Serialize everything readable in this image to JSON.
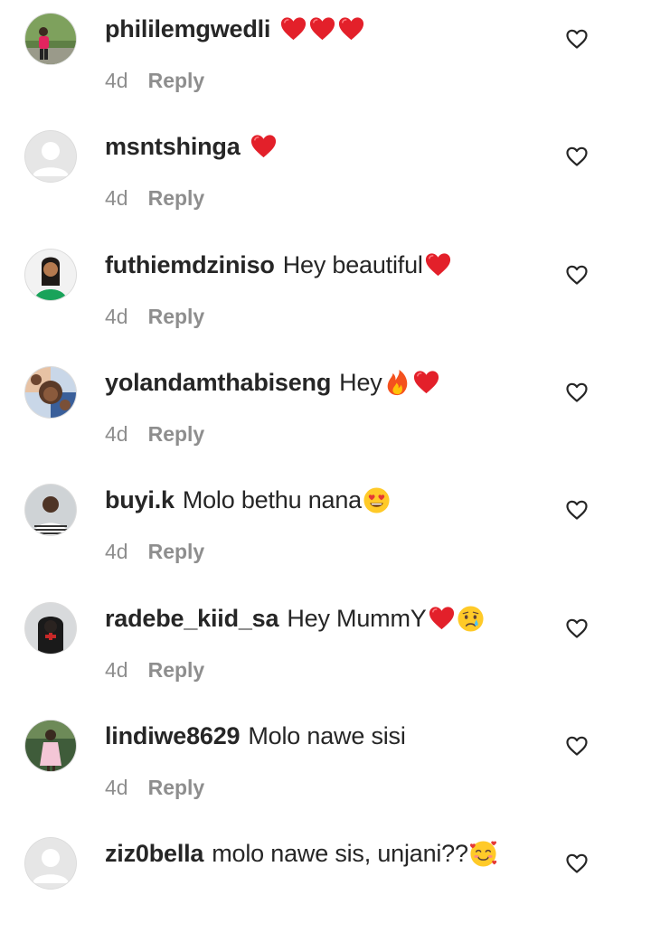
{
  "reply_label": "Reply",
  "colors": {
    "text": "#262626",
    "meta": "#8e8e8e",
    "heart": "#ed1c24"
  },
  "comments": [
    {
      "username": "phililemgwedli",
      "text": "",
      "emojis": [
        "red-heart",
        "red-heart",
        "red-heart"
      ],
      "age": "4d",
      "avatar": "photo-green-outdoor"
    },
    {
      "username": "msntshinga",
      "text": "",
      "emojis": [
        "red-heart"
      ],
      "age": "4d",
      "avatar": "default-avatar"
    },
    {
      "username": "futhiemdziniso",
      "text": "Hey beautiful",
      "emojis": [
        "red-heart"
      ],
      "age": "4d",
      "avatar": "photo-green-top"
    },
    {
      "username": "yolandamthabiseng",
      "text": "Hey",
      "emojis": [
        "fire",
        "red-heart"
      ],
      "age": "4d",
      "avatar": "photo-collage"
    },
    {
      "username": "buyi.k",
      "text": "Molo bethu nana",
      "emojis": [
        "heart-eyes"
      ],
      "age": "4d",
      "avatar": "photo-striped"
    },
    {
      "username": "radebe_kiid_sa",
      "text": "Hey MummY",
      "emojis": [
        "red-heart",
        "crying-face"
      ],
      "age": "4d",
      "avatar": "photo-dark-hoodie"
    },
    {
      "username": "lindiwe8629",
      "text": "Molo nawe sisi",
      "emojis": [],
      "age": "4d",
      "avatar": "photo-pink-dress"
    },
    {
      "username": "ziz0bella",
      "text": "molo nawe sis, unjani??",
      "emojis": [
        "smiling-face-with-hearts"
      ],
      "age": "",
      "avatar": "default-avatar"
    }
  ]
}
